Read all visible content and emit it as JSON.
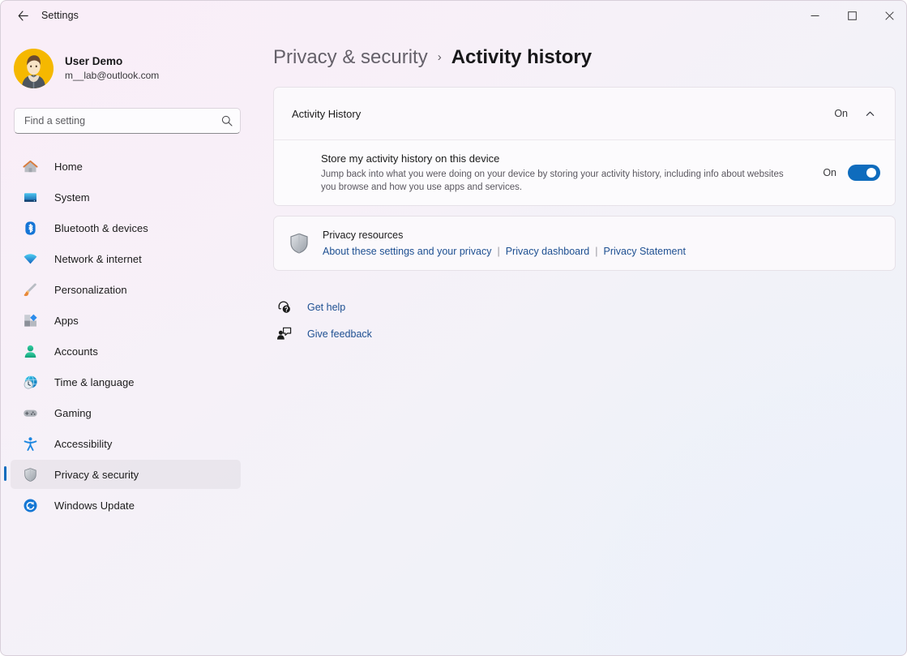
{
  "window": {
    "title": "Settings",
    "back_icon": "back-arrow-icon",
    "controls": {
      "minimize": "minimize-icon",
      "maximize": "maximize-icon",
      "close": "close-icon"
    }
  },
  "sidebar": {
    "profile": {
      "name": "User Demo",
      "email": "m__lab@outlook.com",
      "avatar": "user-avatar"
    },
    "search": {
      "placeholder": "Find a setting",
      "value": "",
      "icon": "search-icon"
    },
    "items": [
      {
        "label": "Home",
        "icon": "home-icon",
        "selected": false
      },
      {
        "label": "System",
        "icon": "system-monitor-icon",
        "selected": false
      },
      {
        "label": "Bluetooth & devices",
        "icon": "bluetooth-icon",
        "selected": false
      },
      {
        "label": "Network & internet",
        "icon": "wifi-icon",
        "selected": false
      },
      {
        "label": "Personalization",
        "icon": "paintbrush-icon",
        "selected": false
      },
      {
        "label": "Apps",
        "icon": "apps-icon",
        "selected": false
      },
      {
        "label": "Accounts",
        "icon": "person-icon",
        "selected": false
      },
      {
        "label": "Time & language",
        "icon": "clock-globe-icon",
        "selected": false
      },
      {
        "label": "Gaming",
        "icon": "gamepad-icon",
        "selected": false
      },
      {
        "label": "Accessibility",
        "icon": "accessibility-icon",
        "selected": false
      },
      {
        "label": "Privacy & security",
        "icon": "shield-icon",
        "selected": true
      },
      {
        "label": "Windows Update",
        "icon": "update-refresh-icon",
        "selected": false
      }
    ]
  },
  "main": {
    "breadcrumb": {
      "parent": "Privacy & security",
      "separator": "›",
      "current": "Activity history"
    },
    "activity_card": {
      "header_title": "Activity History",
      "header_state": "On",
      "expand_icon": "chevron-up-icon",
      "setting": {
        "title": "Store my activity history on this device",
        "description": "Jump back into what you were doing on your device by storing your activity history, including info about websites you browse and how you use apps and services.",
        "toggle_state": "On",
        "toggle_on": true
      }
    },
    "privacy_resources": {
      "icon": "shield-icon",
      "title": "Privacy resources",
      "links": [
        "About these settings and your privacy",
        "Privacy dashboard",
        "Privacy Statement"
      ],
      "separator": "|"
    },
    "help_links": [
      {
        "label": "Get help",
        "icon": "get-help-icon"
      },
      {
        "label": "Give feedback",
        "icon": "give-feedback-icon"
      }
    ]
  },
  "colors": {
    "accent": "#0f6cbd",
    "link": "#1d4f91",
    "card_bg": "#fbf9fc",
    "avatar_bg": "#f5b800"
  }
}
